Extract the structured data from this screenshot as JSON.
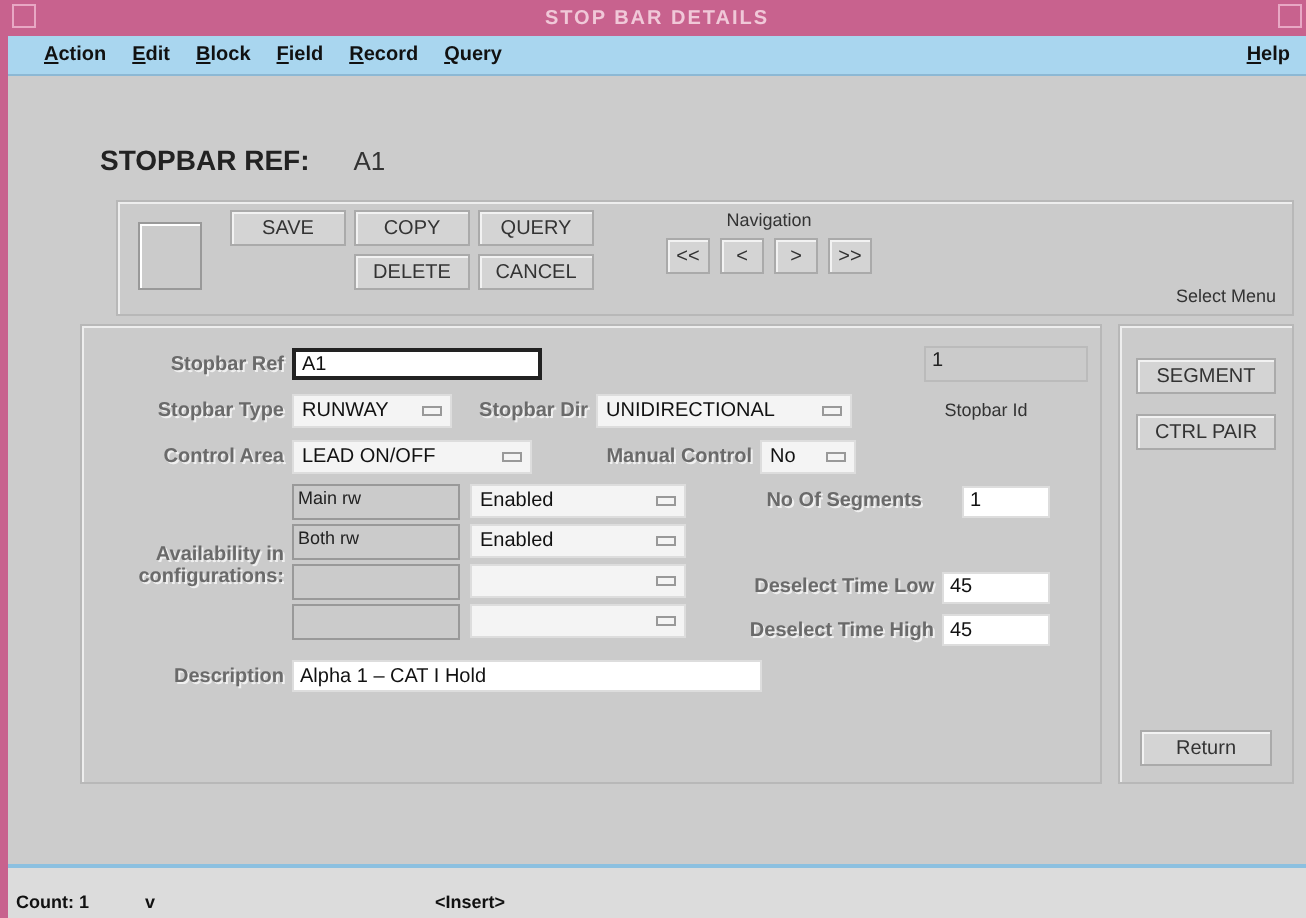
{
  "window": {
    "title": "STOP BAR DETAILS"
  },
  "menu": {
    "left": [
      "Action",
      "Edit",
      "Block",
      "Field",
      "Record",
      "Query"
    ],
    "right": [
      "Help"
    ]
  },
  "header": {
    "label": "STOPBAR REF:",
    "value": "A1"
  },
  "toolbar": {
    "row1": [
      "SAVE",
      "COPY",
      "QUERY"
    ],
    "row2": [
      "DELETE",
      "CANCEL"
    ],
    "navigation": {
      "label": "Navigation",
      "buttons": [
        "<<",
        "<",
        ">",
        ">>"
      ]
    },
    "select_menu": "Select Menu"
  },
  "form": {
    "stopbar_ref": {
      "label": "Stopbar Ref",
      "value": "A1"
    },
    "stopbar_id": {
      "value": "1",
      "label": "Stopbar Id"
    },
    "stopbar_type": {
      "label": "Stopbar Type",
      "value": "RUNWAY"
    },
    "stopbar_dir": {
      "label": "Stopbar Dir",
      "value": "UNIDIRECTIONAL"
    },
    "control_area": {
      "label": "Control Area",
      "value": "LEAD ON/OFF"
    },
    "manual_control": {
      "label": "Manual Control",
      "value": "No"
    },
    "availability": {
      "label": [
        "Availability in",
        "configurations:"
      ],
      "rows": [
        {
          "config": "Main rw",
          "status": "Enabled"
        },
        {
          "config": "Both rw",
          "status": "Enabled"
        },
        {},
        {}
      ]
    },
    "segments": {
      "label": "No Of Segments",
      "value": "1"
    },
    "deselect_low": {
      "label": "Deselect Time Low",
      "value": "45"
    },
    "deselect_high": {
      "label": "Deselect Time High",
      "value": "45"
    },
    "description": {
      "label": "Description",
      "value": "Alpha 1 – CAT I Hold"
    }
  },
  "side_buttons": [
    "SEGMENT",
    "CTRL PAIR"
  ],
  "return_button": "Return",
  "status_bar": {
    "count": "Count: 1",
    "flag": "v",
    "mode": "<Insert>"
  }
}
